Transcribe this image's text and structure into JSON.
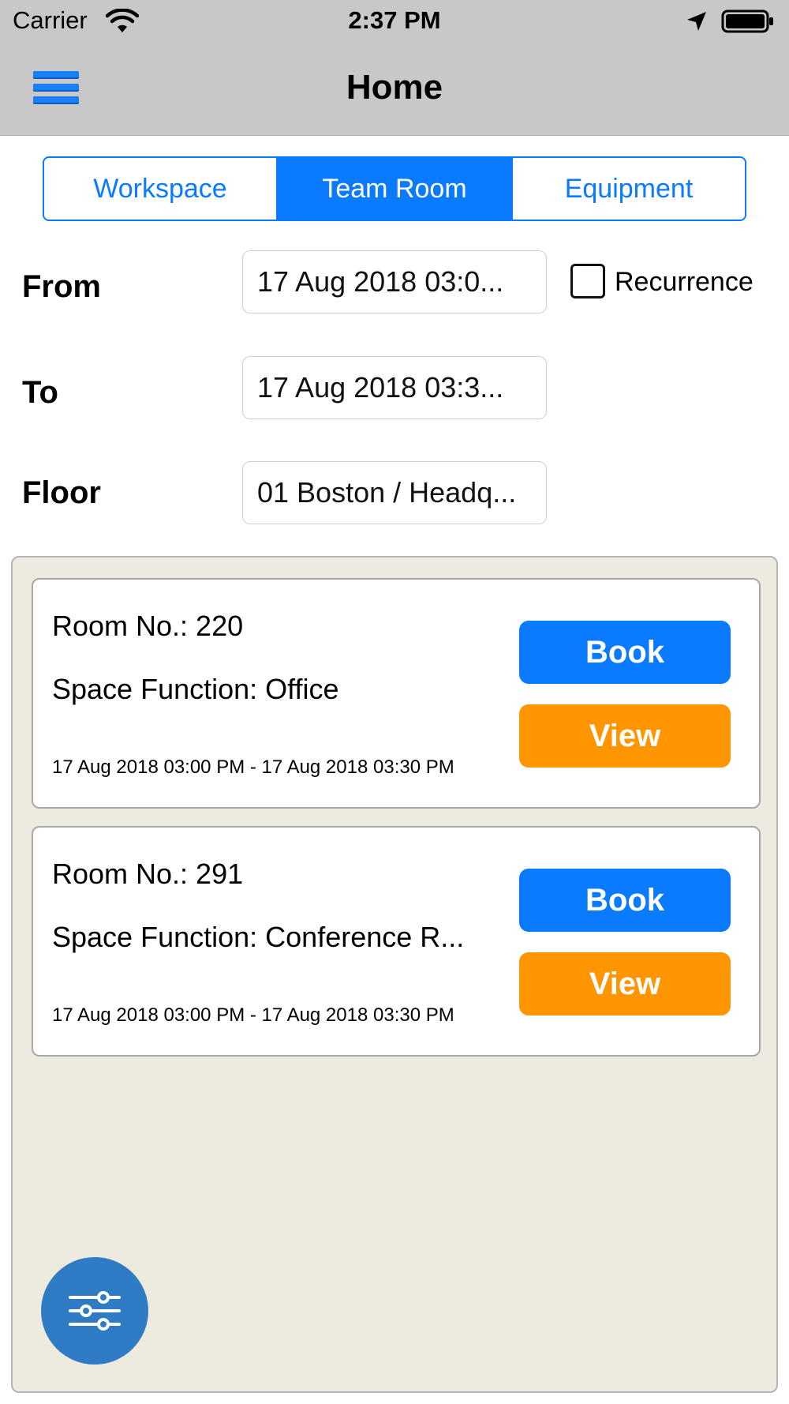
{
  "status_bar": {
    "carrier": "Carrier",
    "time": "2:37 PM"
  },
  "nav": {
    "title": "Home",
    "menu_icon": "hamburger-menu-icon"
  },
  "tabs": [
    {
      "label": "Workspace",
      "active": false
    },
    {
      "label": "Team Room",
      "active": true
    },
    {
      "label": "Equipment",
      "active": false
    }
  ],
  "form": {
    "from_label": "From",
    "from_value": "17 Aug 2018 03:0...",
    "to_label": "To",
    "to_value": "17 Aug 2018 03:3...",
    "floor_label": "Floor",
    "floor_value": "01 Boston / Headq...",
    "recurrence_label": "Recurrence",
    "recurrence_checked": false
  },
  "rooms": [
    {
      "room": "Room No.: 220",
      "function": "Space Function: Office",
      "time": "17 Aug 2018 03:00 PM - 17 Aug 2018 03:30 PM",
      "book_label": "Book",
      "view_label": "View"
    },
    {
      "room": "Room No.: 291",
      "function": "Space Function: Conference R...",
      "time": "17 Aug 2018 03:00 PM - 17 Aug 2018 03:30 PM",
      "book_label": "Book",
      "view_label": "View"
    }
  ],
  "colors": {
    "accent": "#0a7aff",
    "view_button": "#ff9500",
    "list_background": "#edebe0",
    "nav_background": "#c8c8c8",
    "fab": "#2f7cc4"
  },
  "fab_icon": "filter-sliders-icon"
}
